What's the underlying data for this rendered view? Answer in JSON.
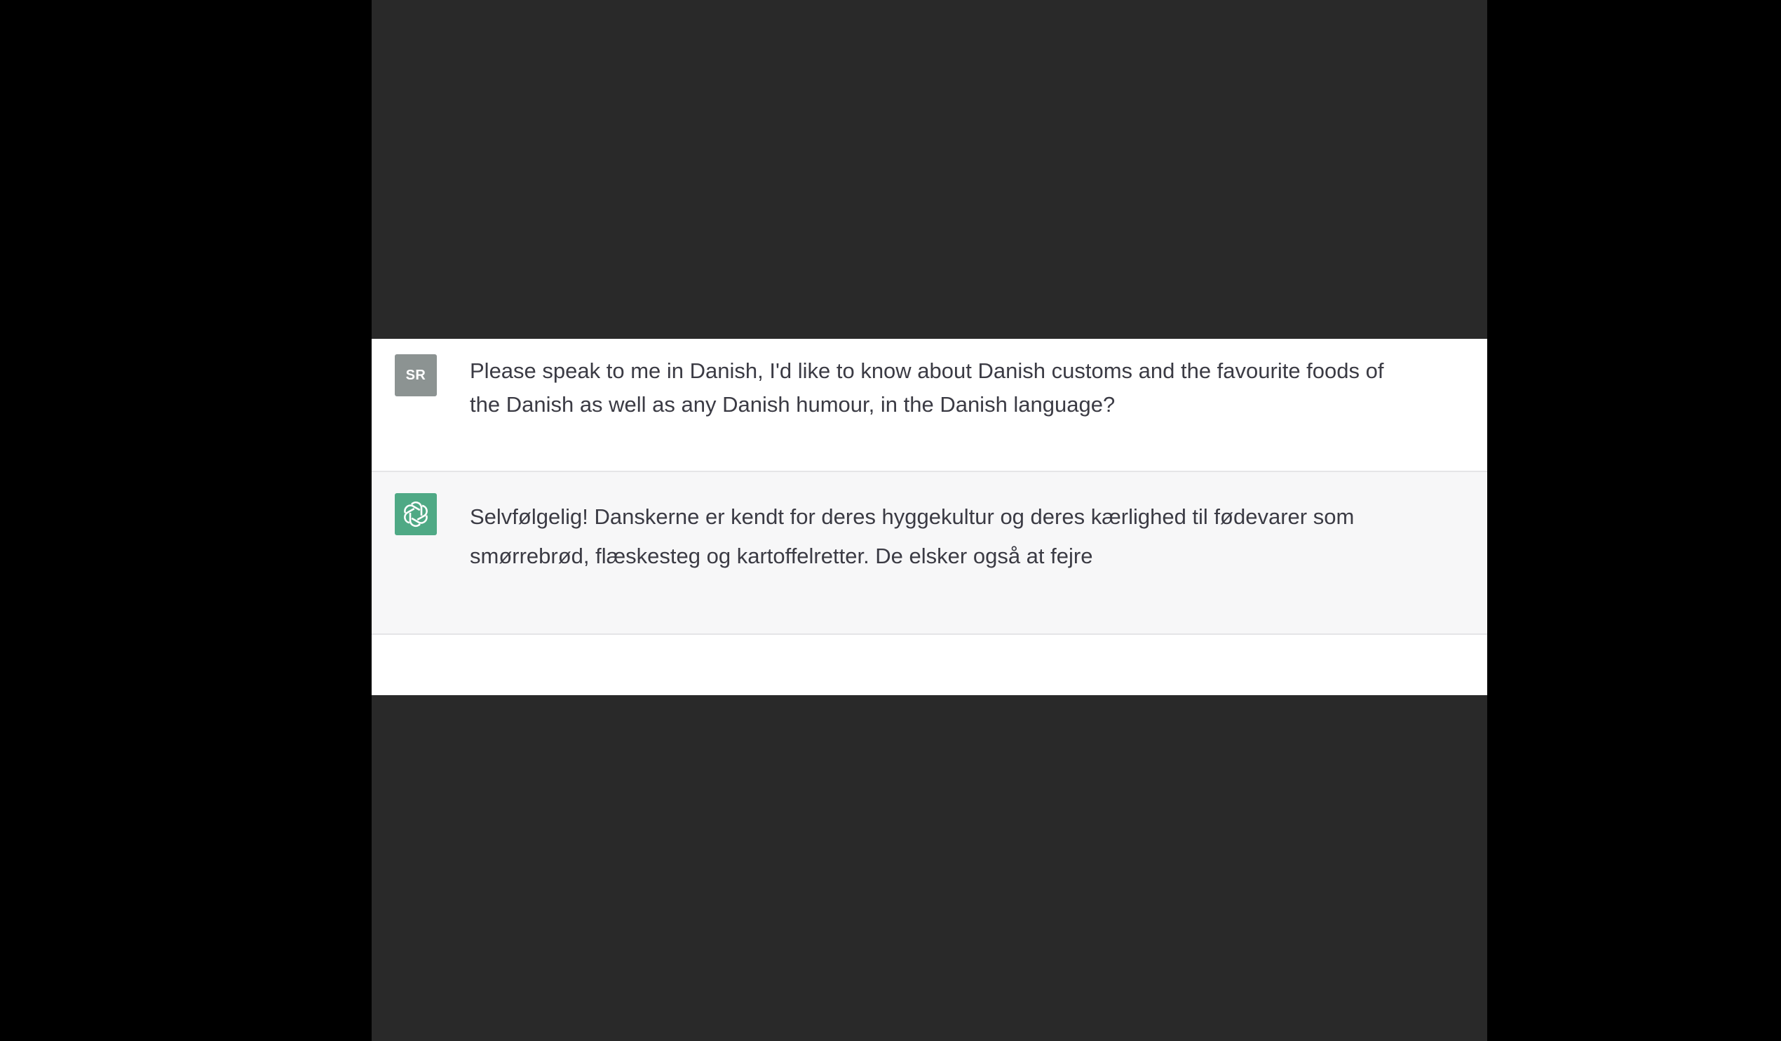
{
  "conversation": {
    "user_message": {
      "avatar_initials": "SR",
      "avatar_color": "#8c9392",
      "text": "Please speak to me in Danish, I'd like to know about Danish customs and the favourite foods of the Danish as well as any Danish humour, in the Danish language?"
    },
    "assistant_message": {
      "avatar_icon": "openai-logo-icon",
      "avatar_color": "#4fa985",
      "text": "Selvfølgelig! Danskerne er kendt for deres hyggekultur og deres kærlighed til fødevarer som smørrebrød, flæskesteg og kartoffelretter. De elsker også at fejre"
    }
  },
  "colors": {
    "letterbox_background": "#292929",
    "outer_background": "#000000",
    "assistant_row_background": "#f7f7f8",
    "text_color": "#3b3b44"
  }
}
